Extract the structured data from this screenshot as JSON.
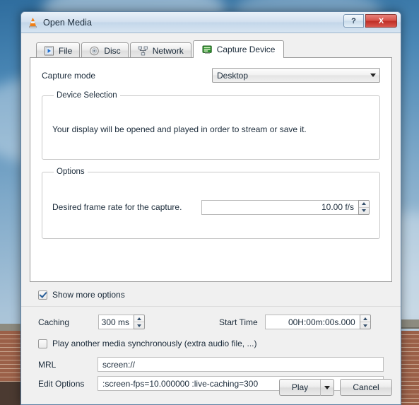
{
  "window": {
    "title": "Open Media",
    "app_icon": "vlc-cone-icon",
    "help_label": "?",
    "close_label": "X"
  },
  "tabs": [
    {
      "label": "File",
      "icon": "file-icon",
      "active": false
    },
    {
      "label": "Disc",
      "icon": "disc-icon",
      "active": false
    },
    {
      "label": "Network",
      "icon": "network-icon",
      "active": false
    },
    {
      "label": "Capture Device",
      "icon": "capture-card-icon",
      "active": true
    }
  ],
  "capture": {
    "mode_label": "Capture mode",
    "mode_value": "Desktop",
    "device_group_title": "Device Selection",
    "device_description": "Your display will be opened and played in order to stream or save it.",
    "options_group_title": "Options",
    "frame_rate_label": "Desired frame rate for the capture.",
    "frame_rate_value": "10.00 f/s"
  },
  "more_options": {
    "show_more_label": "Show more options",
    "show_more_checked": true,
    "caching_label": "Caching",
    "caching_value": "300 ms",
    "start_time_label": "Start Time",
    "start_time_value": "00H:00m:00s.000",
    "sync_label": "Play another media synchronously (extra audio file, ...)",
    "sync_checked": false,
    "mrl_label": "MRL",
    "mrl_value": "screen://",
    "edit_options_label": "Edit Options",
    "edit_options_value": ":screen-fps=10.000000 :live-caching=300"
  },
  "footer": {
    "play_label": "Play",
    "cancel_label": "Cancel"
  },
  "annotation": {
    "arrow_color": "#ff0000",
    "arrow_direction": "left"
  },
  "colors": {
    "dialog_bg": "#f0f0f0",
    "panel_bg": "#ffffff",
    "text": "#1b2b3a",
    "close_button": "#bf2f27",
    "accent_check": "#2a5f99"
  }
}
